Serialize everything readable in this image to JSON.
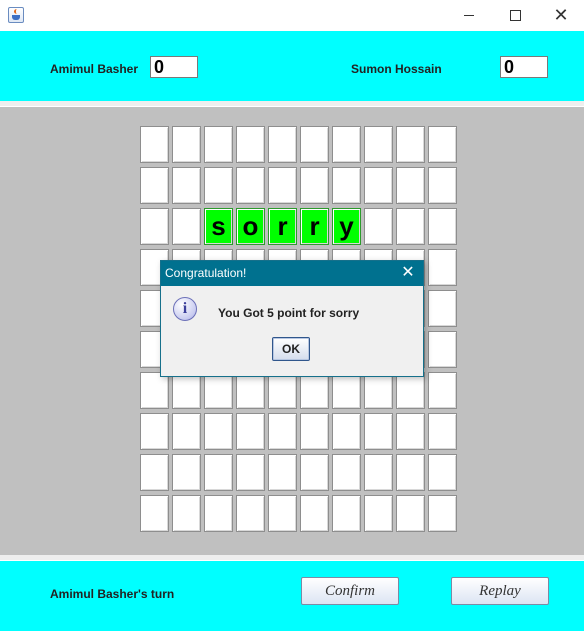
{
  "window": {
    "title": "",
    "controls": {
      "minimize_icon": "minimize-icon",
      "maximize_icon": "maximize-icon",
      "close_icon": "close-icon",
      "close_glyph": "✕"
    }
  },
  "players": [
    {
      "name": "Amimul Basher",
      "score": "0"
    },
    {
      "name": "Sumon Hossain",
      "score": "0"
    }
  ],
  "board": {
    "rows": 10,
    "cols": 10,
    "highlight_color": "#00ff00",
    "filled_cells": [
      {
        "row": 2,
        "col": 2,
        "letter": "s"
      },
      {
        "row": 2,
        "col": 3,
        "letter": "o"
      },
      {
        "row": 2,
        "col": 4,
        "letter": "r"
      },
      {
        "row": 2,
        "col": 5,
        "letter": "r"
      },
      {
        "row": 2,
        "col": 6,
        "letter": "y"
      }
    ]
  },
  "status": {
    "turn_text": "Amimul Basher's turn"
  },
  "buttons": {
    "confirm": "Confirm",
    "replay": "Replay"
  },
  "dialog": {
    "title": "Congratulation!",
    "message": "You Got 5 point for sorry",
    "ok_label": "OK",
    "icon": "info-icon",
    "close_glyph": "✕"
  },
  "colors": {
    "panel": "#00ffff",
    "board_bg": "#c0c0c0",
    "dialog_title_bg": "#00718f"
  }
}
